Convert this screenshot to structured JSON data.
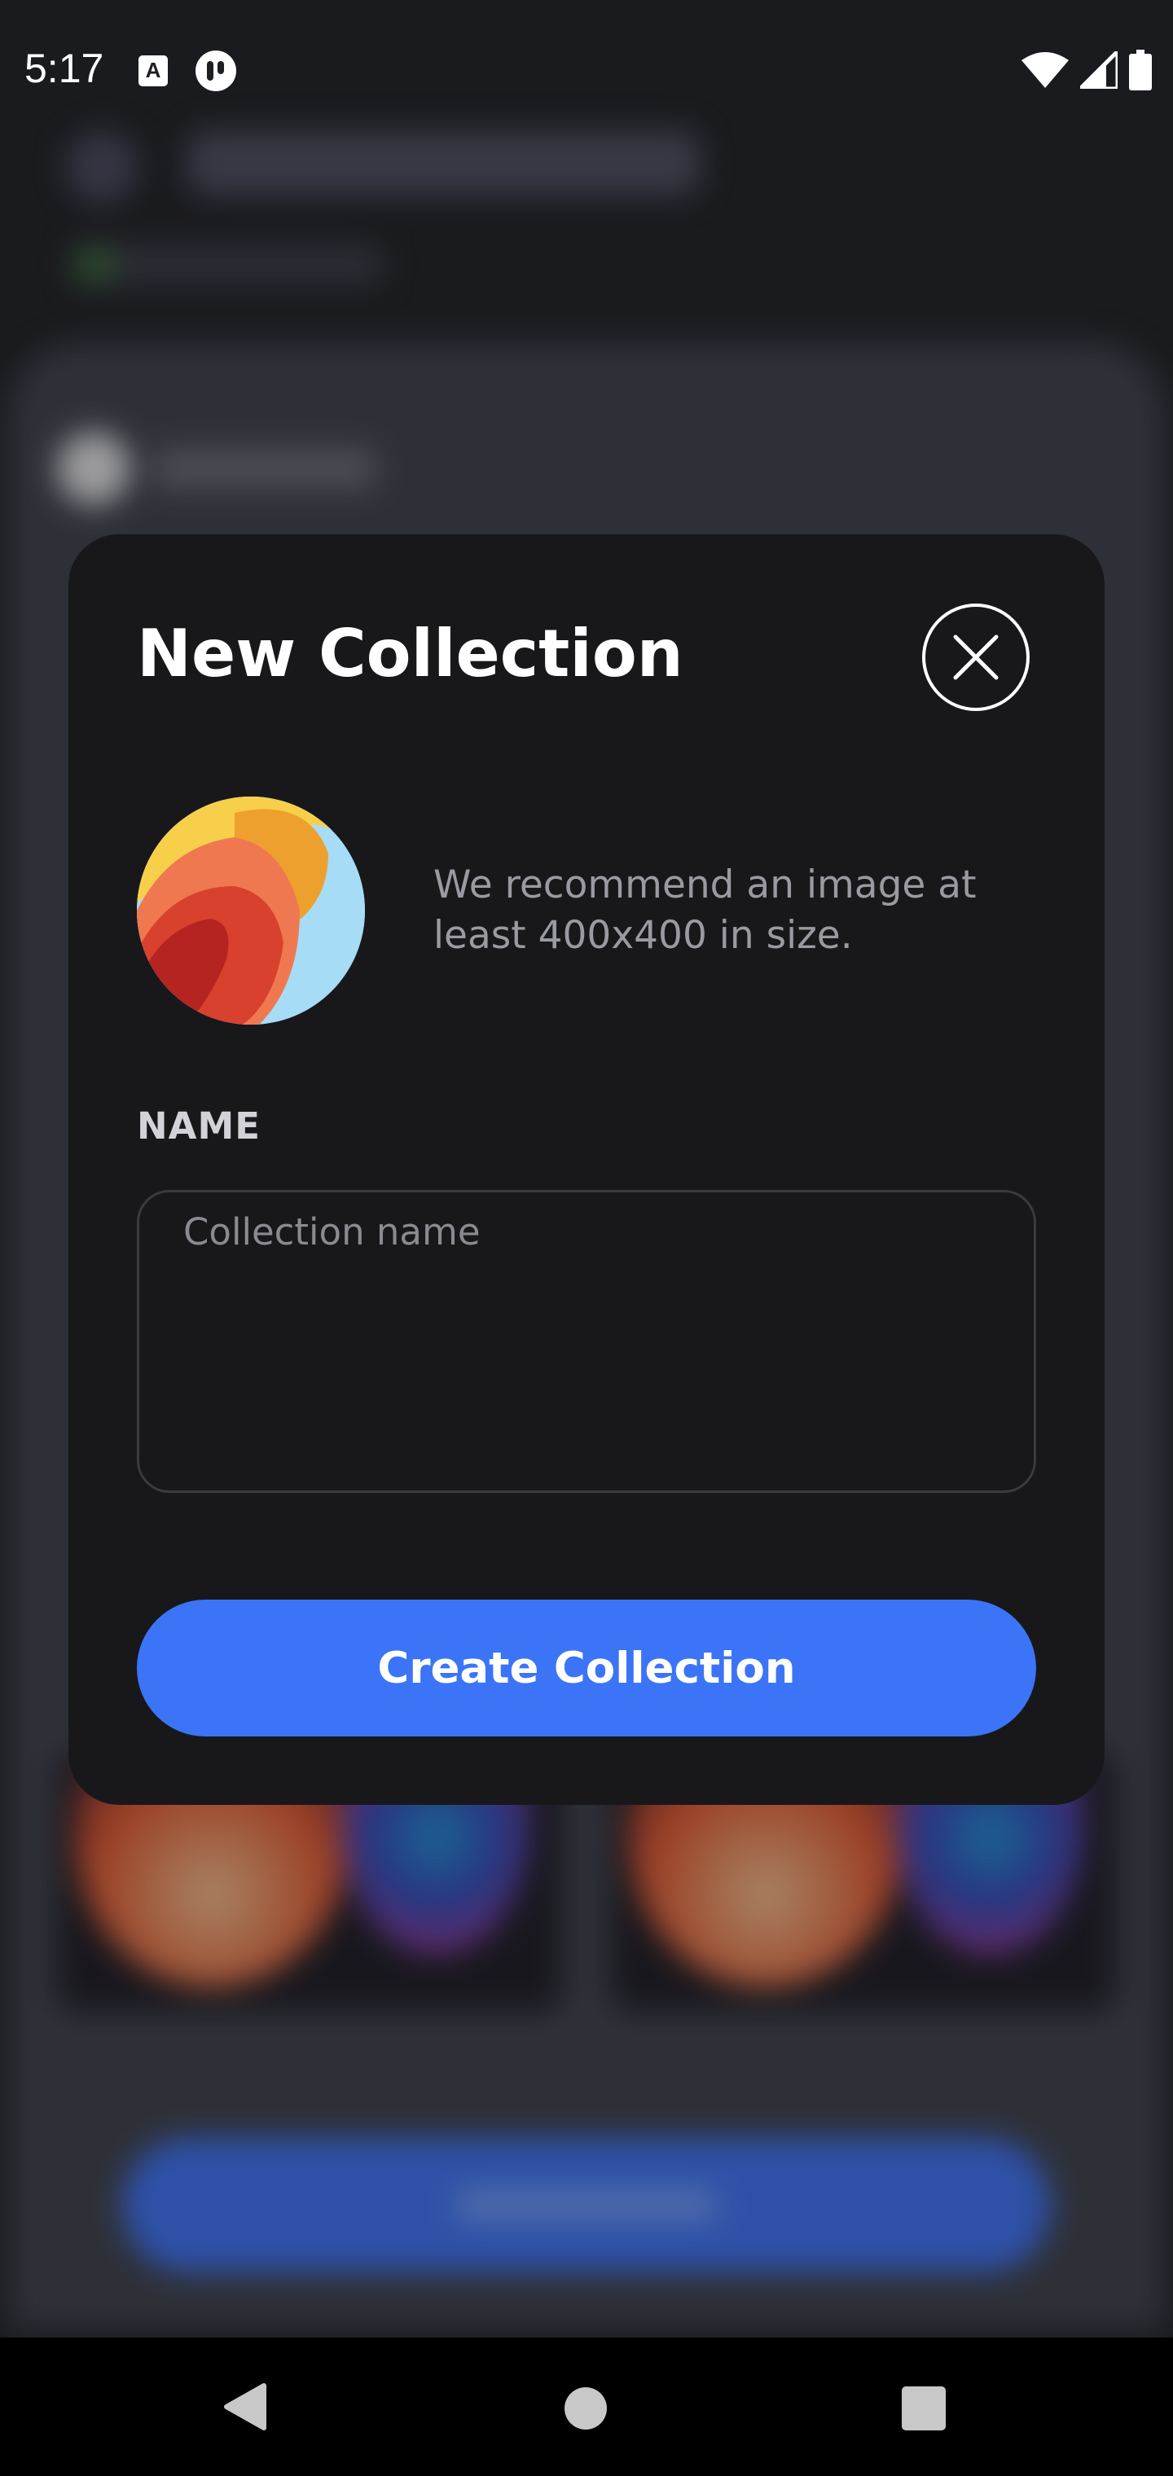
{
  "status_bar": {
    "time": "5:17",
    "notification_letter": "A",
    "icons": [
      "notification-a-icon",
      "app-notification-icon",
      "wifi-icon",
      "signal-icon",
      "battery-icon"
    ]
  },
  "modal": {
    "title": "New Collection",
    "close_icon": "close-icon",
    "image_hint": "We recommend an image at least 400x400 in size.",
    "name_label": "NAME",
    "name_placeholder": "Collection name",
    "name_value": "",
    "create_button_label": "Create Collection"
  },
  "nav_bar": {
    "icons": [
      "back-icon",
      "home-icon",
      "recents-icon"
    ]
  },
  "colors": {
    "modal_background": "#18181b",
    "accent": "#3b74f6",
    "muted_text": "#9a9aa2"
  }
}
